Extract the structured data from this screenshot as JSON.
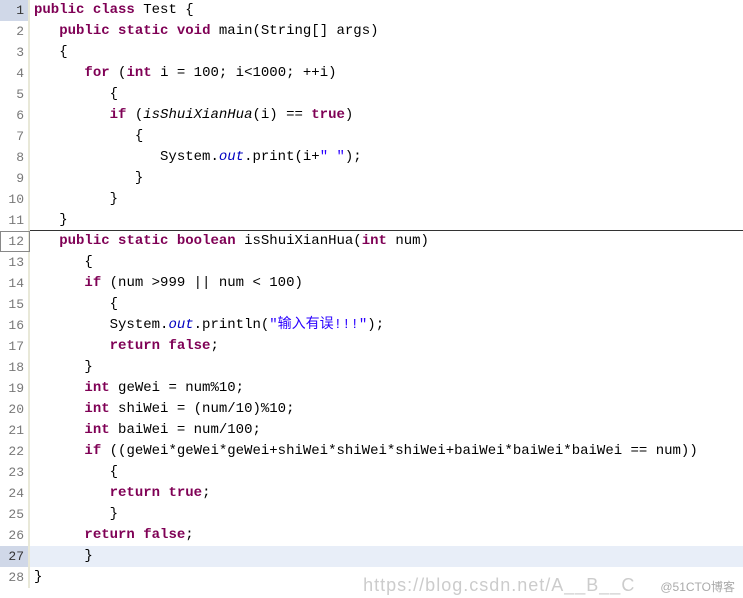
{
  "lines": {
    "l1_kw1": "public",
    "l1_kw2": "class",
    "l1_name": " Test {",
    "l2_kw1": "public",
    "l2_kw2": "static",
    "l2_kw3": "void",
    "l2_txt": " main(String[] args)",
    "l3_txt": "{",
    "l4_kw1": "for",
    "l4_txt1": " (",
    "l4_kw2": "int",
    "l4_txt2": " i = 100; i<1000; ++i)",
    "l5_txt": "{",
    "l6_kw1": "if",
    "l6_txt1": " (",
    "l6_italic": "isShuiXianHua",
    "l6_txt2": "(i) == ",
    "l6_kw2": "true",
    "l6_txt3": ")",
    "l7_txt": "{",
    "l8_txt1": "System.",
    "l8_italic": "out",
    "l8_txt2": ".print(i+",
    "l8_str": "\" \"",
    "l8_txt3": ");",
    "l9_txt": "}",
    "l10_txt": "}",
    "l11_txt": "}",
    "l12_kw1": "public",
    "l12_kw2": "static",
    "l12_kw3": "boolean",
    "l12_txt1": " isShuiXianHua(",
    "l12_kw4": "int",
    "l12_txt2": " num)",
    "l13_txt": "{",
    "l14_kw1": "if",
    "l14_txt": " (num >999 || num < 100)",
    "l15_txt": "{",
    "l16_txt1": "System.",
    "l16_italic": "out",
    "l16_txt2": ".println(",
    "l16_str": "\"输入有误!!!\"",
    "l16_txt3": ");",
    "l17_kw1": "return",
    "l17_kw2": "false",
    "l17_txt": ";",
    "l18_txt": "}",
    "l19_kw1": "int",
    "l19_txt": " geWei = num%10;",
    "l20_kw1": "int",
    "l20_txt": " shiWei = (num/10)%10;",
    "l21_kw1": "int",
    "l21_txt": " baiWei = num/100;",
    "l22_kw1": "if",
    "l22_txt": " ((geWei*geWei*geWei+shiWei*shiWei*shiWei+baiWei*baiWei*baiWei == num))",
    "l23_txt": "{",
    "l24_kw1": "return",
    "l24_kw2": "true",
    "l24_txt": ";",
    "l25_txt": "}",
    "l26_kw1": "return",
    "l26_kw2": "false",
    "l26_txt": ";",
    "l27_txt": "}",
    "l28_txt": "}"
  },
  "line_numbers": {
    "n1": "1",
    "n2": "2",
    "n3": "3",
    "n4": "4",
    "n5": "5",
    "n6": "6",
    "n7": "7",
    "n8": "8",
    "n9": "9",
    "n10": "10",
    "n11": "11",
    "n12": "12",
    "n13": "13",
    "n14": "14",
    "n15": "15",
    "n16": "16",
    "n17": "17",
    "n18": "18",
    "n19": "19",
    "n20": "20",
    "n21": "21",
    "n22": "22",
    "n23": "23",
    "n24": "24",
    "n25": "25",
    "n26": "26",
    "n27": "27",
    "n28": "28"
  },
  "watermark": {
    "left": "https://blog.csdn.net/A__B__C",
    "right": "@51CTO博客"
  },
  "indent": {
    "i0": "",
    "i1": "   ",
    "i2": "      ",
    "i3": "         ",
    "i4": "            ",
    "i5": "               "
  }
}
